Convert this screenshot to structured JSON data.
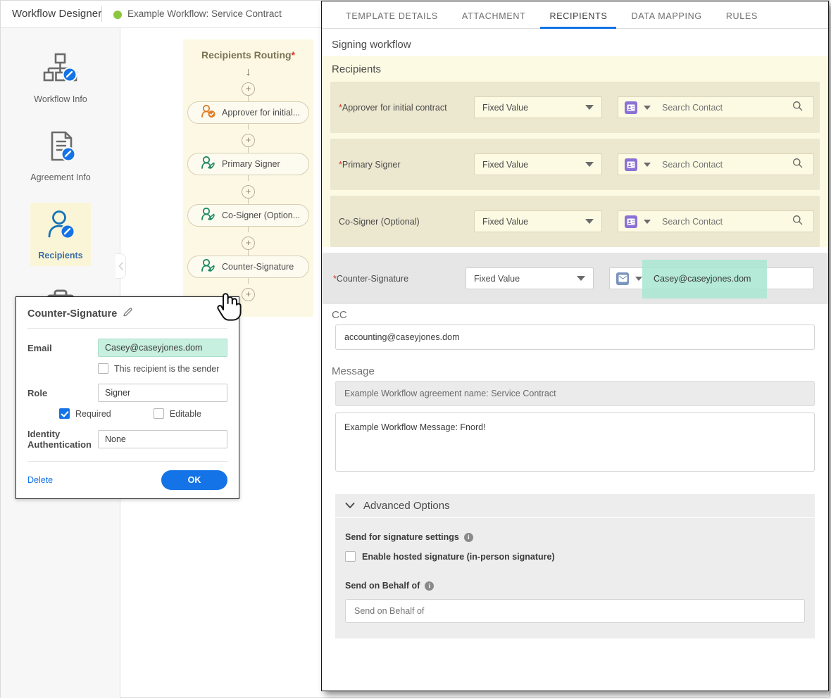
{
  "topbar": {
    "app_title": "Workflow Designer",
    "workflow_name": "Example Workflow: Service Contract",
    "status_color": "#8cc63e"
  },
  "rail": {
    "items": [
      {
        "label": "Workflow Info",
        "icon": "workflow-info-icon",
        "active": false
      },
      {
        "label": "Agreement Info",
        "icon": "agreement-info-icon",
        "active": false
      },
      {
        "label": "Recipients",
        "icon": "recipients-icon",
        "active": true
      },
      {
        "label": "",
        "icon": "documents-icon",
        "active": false
      }
    ]
  },
  "canvas": {
    "routing_title": "Recipients Routing",
    "routing_required_mark": "*",
    "nodes": [
      {
        "label": "Approver for initial...",
        "icon": "approver-icon",
        "color": "#e07c24"
      },
      {
        "label": "Primary Signer",
        "icon": "signer-icon",
        "color": "#1d8a63"
      },
      {
        "label": "Co-Signer (Option...",
        "icon": "signer-icon",
        "color": "#1d8a63"
      },
      {
        "label": "Counter-Signature",
        "icon": "signer-icon",
        "color": "#1d8a63"
      }
    ],
    "add_button_label": "+"
  },
  "popover": {
    "title": "Counter-Signature",
    "edit_icon": "pencil-icon",
    "email_label": "Email",
    "email_value": "Casey@caseyjones.dom",
    "sender_checkbox_label": "This recipient is the sender",
    "sender_checked": false,
    "role_label": "Role",
    "role_value": "Signer",
    "required_label": "Required",
    "required_checked": true,
    "editable_label": "Editable",
    "editable_checked": false,
    "identity_label": "Identity Authentication",
    "identity_value": "None",
    "delete_label": "Delete",
    "ok_label": "OK",
    "accent_color": "#1473e6",
    "highlight_color": "#c8f0e1"
  },
  "panel": {
    "tabs": [
      {
        "label": "TEMPLATE DETAILS",
        "active": false
      },
      {
        "label": "ATTACHMENT",
        "active": false
      },
      {
        "label": "RECIPIENTS",
        "active": true
      },
      {
        "label": "DATA MAPPING",
        "active": false
      },
      {
        "label": "RULES",
        "active": false
      }
    ],
    "heading": "Signing workflow",
    "recipients_title": "Recipients",
    "recipients": [
      {
        "label": "Approver for initial contract",
        "required": true,
        "value_type": "Fixed Value",
        "contact_icon": "contact-card-icon",
        "contact_placeholder": "Search Contact",
        "contact_value": "",
        "has_search": true,
        "style": "yellow"
      },
      {
        "label": "Primary Signer",
        "required": true,
        "value_type": "Fixed Value",
        "contact_icon": "contact-card-icon",
        "contact_placeholder": "Search Contact",
        "contact_value": "",
        "has_search": true,
        "style": "yellow"
      },
      {
        "label": "Co-Signer (Optional)",
        "required": false,
        "value_type": "Fixed Value",
        "contact_icon": "contact-card-icon",
        "contact_placeholder": "Search Contact",
        "contact_value": "",
        "has_search": true,
        "style": "yellow"
      },
      {
        "label": "Counter-Signature",
        "required": true,
        "value_type": "Fixed Value",
        "contact_icon": "email-icon",
        "contact_placeholder": "",
        "contact_value": "Casey@caseyjones.dom",
        "has_search": false,
        "style": "grey"
      }
    ],
    "cc_label": "CC",
    "cc_value": "accounting@caseyjones.dom",
    "message_label": "Message",
    "agreement_name_value": "Example Workflow agreement name: Service Contract",
    "message_value": "Example Workflow Message: Fnord!",
    "advanced": {
      "title": "Advanced Options",
      "chevron": "chevron-down-icon",
      "signature_settings_label": "Send for signature settings",
      "hosted_signature_label": "Enable hosted signature (in-person signature)",
      "hosted_signature_checked": false,
      "send_on_behalf_label": "Send on Behalf of",
      "send_on_behalf_placeholder": "Send on Behalf of",
      "send_on_behalf_value": "",
      "info_icon": "info-icon"
    }
  }
}
